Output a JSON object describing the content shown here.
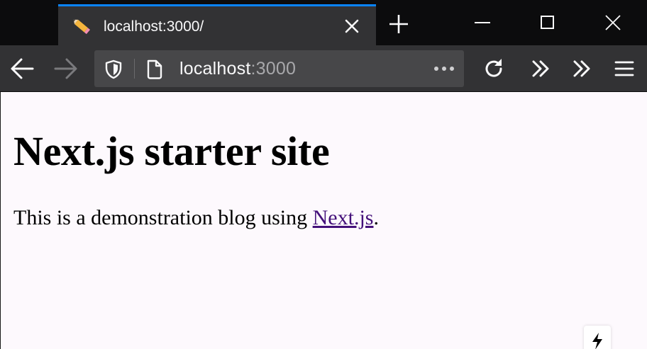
{
  "browser": {
    "tab": {
      "title": "localhost:3000/",
      "favicon": "pencil-icon"
    },
    "accent": "#0a84ff",
    "url": {
      "host": "localhost",
      "port": ":3000"
    }
  },
  "page": {
    "heading": "Next.js starter site",
    "para_before": "This is a demonstration blog using ",
    "link_text": "Next.js",
    "para_after": ".",
    "link_color": "#44117a",
    "background": "#fdf9fd"
  },
  "icons": {
    "tab_close": "close-icon",
    "new_tab": "plus-icon",
    "minimize": "minimize-icon",
    "maximize": "maximize-icon",
    "window_close": "close-icon",
    "back": "arrow-left-icon",
    "forward": "arrow-right-icon",
    "tracking": "shield-icon",
    "site_info": "page-icon",
    "page_actions": "ellipsis-icon",
    "reload": "reload-icon",
    "overflow": "double-chevron-icon",
    "menu": "hamburger-icon",
    "dev_indicator": "lightning-icon"
  }
}
